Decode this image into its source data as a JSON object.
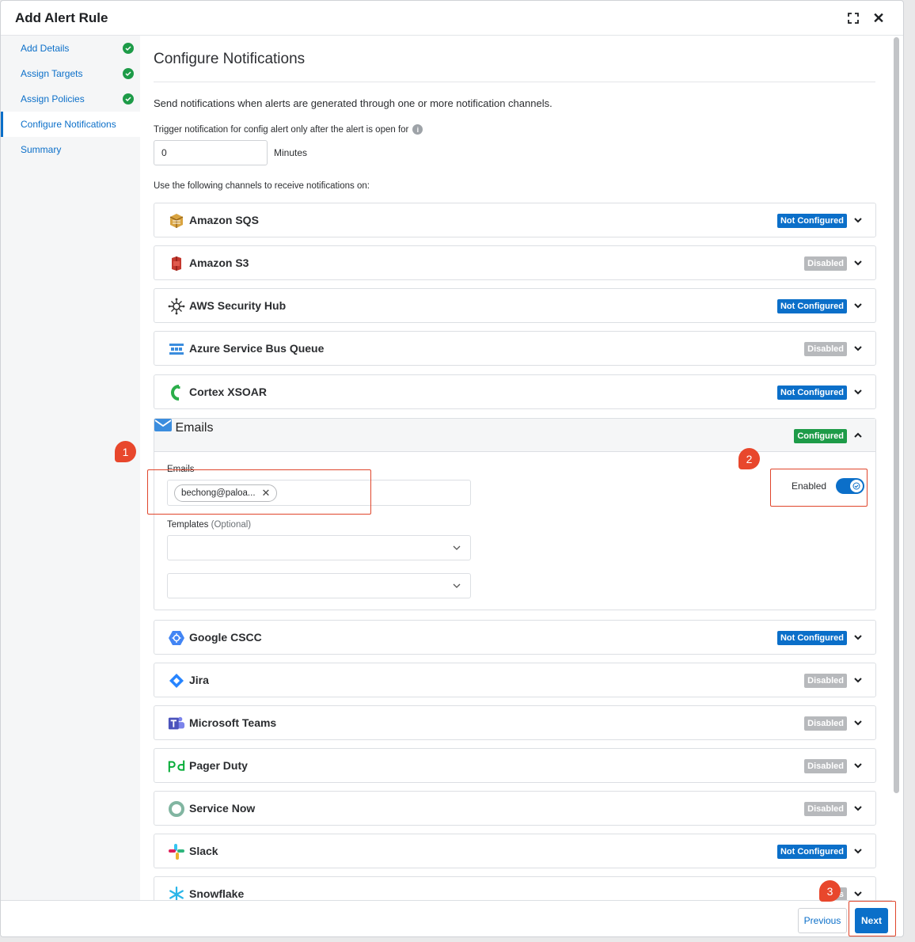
{
  "modal": {
    "title": "Add Alert Rule"
  },
  "sidebar": {
    "items": [
      {
        "label": "Add Details",
        "done": true
      },
      {
        "label": "Assign Targets",
        "done": true
      },
      {
        "label": "Assign Policies",
        "done": true
      },
      {
        "label": "Configure Notifications",
        "active": true
      },
      {
        "label": "Summary"
      }
    ]
  },
  "main": {
    "title": "Configure Notifications",
    "description": "Send notifications when alerts are generated through one or more notification channels.",
    "trigger_label": "Trigger notification for config alert only after the alert is open for",
    "trigger_value": "0",
    "trigger_unit": "Minutes",
    "channels_label": "Use the following channels to receive notifications on:"
  },
  "channels": [
    {
      "name": "Amazon SQS",
      "status": "Not Configured"
    },
    {
      "name": "Amazon S3",
      "status": "Disabled"
    },
    {
      "name": "AWS Security Hub",
      "status": "Not Configured"
    },
    {
      "name": "Azure Service Bus Queue",
      "status": "Disabled"
    },
    {
      "name": "Cortex XSOAR",
      "status": "Not Configured"
    },
    {
      "name": "Emails",
      "status": "Configured"
    },
    {
      "name": "Google CSCC",
      "status": "Not Configured"
    },
    {
      "name": "Jira",
      "status": "Disabled"
    },
    {
      "name": "Microsoft Teams",
      "status": "Disabled"
    },
    {
      "name": "Pager Duty",
      "status": "Disabled"
    },
    {
      "name": "Service Now",
      "status": "Disabled"
    },
    {
      "name": "Slack",
      "status": "Not Configured"
    },
    {
      "name": "Snowflake",
      "status": "Dis"
    }
  ],
  "emails": {
    "emails_label": "Emails",
    "chip": "bechong@paloa...",
    "templates_label": "Templates",
    "templates_optional": "(Optional)",
    "toggle_label": "Enabled"
  },
  "footer": {
    "previous": "Previous",
    "next": "Next"
  },
  "annotations": [
    "1",
    "2",
    "3"
  ],
  "colors": {
    "primary": "#0b6fc9",
    "success": "#1d9b48",
    "disabled": "#b7b9bc",
    "annotation": "#e0452b"
  }
}
